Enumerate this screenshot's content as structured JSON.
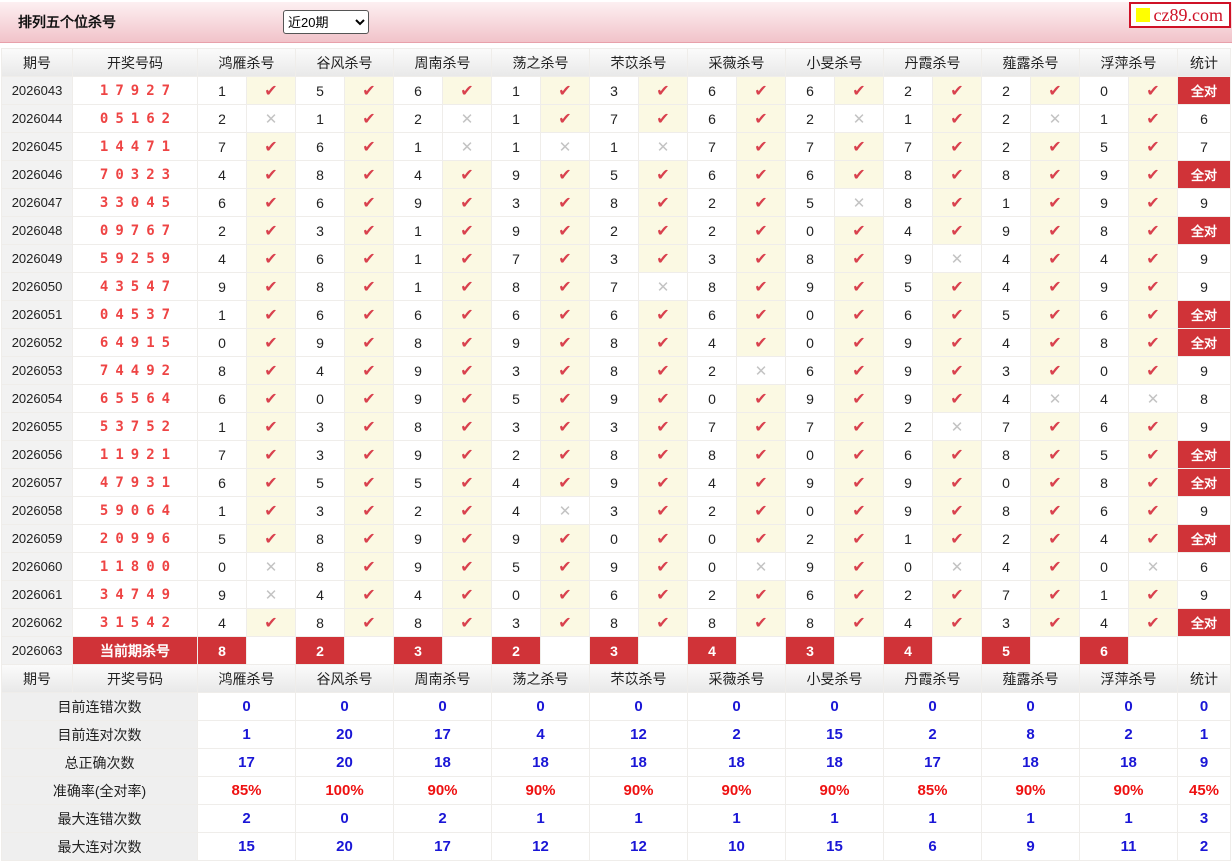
{
  "page": {
    "title": "排列五个位杀号",
    "period_select": "近20期",
    "logo": "cz89.com"
  },
  "icons": {
    "check": "✔",
    "cross": "✕",
    "logo_square": "yellow-square"
  },
  "colors": {
    "accent_red": "#d03338",
    "check_red": "#d9414e",
    "cross_gray": "#c3c3c3",
    "number_red": "#ee4444",
    "summary_blue": "#1a16d6",
    "percent_red": "#ee1111",
    "topbar_pink": "#f1c3ca"
  },
  "columns": {
    "period": "期号",
    "numbers": "开奖号码",
    "experts": [
      "鸿雁杀号",
      "谷风杀号",
      "周南杀号",
      "荡之杀号",
      "芣苡杀号",
      "采薇杀号",
      "小旻杀号",
      "丹霞杀号",
      "薤露杀号",
      "浮萍杀号"
    ],
    "stat": "统计"
  },
  "all_correct_label": "全对",
  "rows": [
    {
      "period": "2026043",
      "numbers": "17927",
      "kills": [
        [
          "1",
          1
        ],
        [
          "5",
          1
        ],
        [
          "6",
          1
        ],
        [
          "1",
          1
        ],
        [
          "3",
          1
        ],
        [
          "6",
          1
        ],
        [
          "6",
          1
        ],
        [
          "2",
          1
        ],
        [
          "2",
          1
        ],
        [
          "0",
          1
        ]
      ],
      "stat": "全对"
    },
    {
      "period": "2026044",
      "numbers": "05162",
      "kills": [
        [
          "2",
          0
        ],
        [
          "1",
          1
        ],
        [
          "2",
          0
        ],
        [
          "1",
          1
        ],
        [
          "7",
          1
        ],
        [
          "6",
          1
        ],
        [
          "2",
          0
        ],
        [
          "1",
          1
        ],
        [
          "2",
          0
        ],
        [
          "1",
          1
        ]
      ],
      "stat": "6"
    },
    {
      "period": "2026045",
      "numbers": "14471",
      "kills": [
        [
          "7",
          1
        ],
        [
          "6",
          1
        ],
        [
          "1",
          0
        ],
        [
          "1",
          0
        ],
        [
          "1",
          0
        ],
        [
          "7",
          1
        ],
        [
          "7",
          1
        ],
        [
          "7",
          1
        ],
        [
          "2",
          1
        ],
        [
          "5",
          1
        ]
      ],
      "stat": "7"
    },
    {
      "period": "2026046",
      "numbers": "70323",
      "kills": [
        [
          "4",
          1
        ],
        [
          "8",
          1
        ],
        [
          "4",
          1
        ],
        [
          "9",
          1
        ],
        [
          "5",
          1
        ],
        [
          "6",
          1
        ],
        [
          "6",
          1
        ],
        [
          "8",
          1
        ],
        [
          "8",
          1
        ],
        [
          "9",
          1
        ]
      ],
      "stat": "全对"
    },
    {
      "period": "2026047",
      "numbers": "33045",
      "kills": [
        [
          "6",
          1
        ],
        [
          "6",
          1
        ],
        [
          "9",
          1
        ],
        [
          "3",
          1
        ],
        [
          "8",
          1
        ],
        [
          "2",
          1
        ],
        [
          "5",
          0
        ],
        [
          "8",
          1
        ],
        [
          "1",
          1
        ],
        [
          "9",
          1
        ]
      ],
      "stat": "9"
    },
    {
      "period": "2026048",
      "numbers": "09767",
      "kills": [
        [
          "2",
          1
        ],
        [
          "3",
          1
        ],
        [
          "1",
          1
        ],
        [
          "9",
          1
        ],
        [
          "2",
          1
        ],
        [
          "2",
          1
        ],
        [
          "0",
          1
        ],
        [
          "4",
          1
        ],
        [
          "9",
          1
        ],
        [
          "8",
          1
        ]
      ],
      "stat": "全对"
    },
    {
      "period": "2026049",
      "numbers": "59259",
      "kills": [
        [
          "4",
          1
        ],
        [
          "6",
          1
        ],
        [
          "1",
          1
        ],
        [
          "7",
          1
        ],
        [
          "3",
          1
        ],
        [
          "3",
          1
        ],
        [
          "8",
          1
        ],
        [
          "9",
          0
        ],
        [
          "4",
          1
        ],
        [
          "4",
          1
        ]
      ],
      "stat": "9"
    },
    {
      "period": "2026050",
      "numbers": "43547",
      "kills": [
        [
          "9",
          1
        ],
        [
          "8",
          1
        ],
        [
          "1",
          1
        ],
        [
          "8",
          1
        ],
        [
          "7",
          0
        ],
        [
          "8",
          1
        ],
        [
          "9",
          1
        ],
        [
          "5",
          1
        ],
        [
          "4",
          1
        ],
        [
          "9",
          1
        ]
      ],
      "stat": "9"
    },
    {
      "period": "2026051",
      "numbers": "04537",
      "kills": [
        [
          "1",
          1
        ],
        [
          "6",
          1
        ],
        [
          "6",
          1
        ],
        [
          "6",
          1
        ],
        [
          "6",
          1
        ],
        [
          "6",
          1
        ],
        [
          "0",
          1
        ],
        [
          "6",
          1
        ],
        [
          "5",
          1
        ],
        [
          "6",
          1
        ]
      ],
      "stat": "全对"
    },
    {
      "period": "2026052",
      "numbers": "64915",
      "kills": [
        [
          "0",
          1
        ],
        [
          "9",
          1
        ],
        [
          "8",
          1
        ],
        [
          "9",
          1
        ],
        [
          "8",
          1
        ],
        [
          "4",
          1
        ],
        [
          "0",
          1
        ],
        [
          "9",
          1
        ],
        [
          "4",
          1
        ],
        [
          "8",
          1
        ]
      ],
      "stat": "全对"
    },
    {
      "period": "2026053",
      "numbers": "74492",
      "kills": [
        [
          "8",
          1
        ],
        [
          "4",
          1
        ],
        [
          "9",
          1
        ],
        [
          "3",
          1
        ],
        [
          "8",
          1
        ],
        [
          "2",
          0
        ],
        [
          "6",
          1
        ],
        [
          "9",
          1
        ],
        [
          "3",
          1
        ],
        [
          "0",
          1
        ]
      ],
      "stat": "9"
    },
    {
      "period": "2026054",
      "numbers": "65564",
      "kills": [
        [
          "6",
          1
        ],
        [
          "0",
          1
        ],
        [
          "9",
          1
        ],
        [
          "5",
          1
        ],
        [
          "9",
          1
        ],
        [
          "0",
          1
        ],
        [
          "9",
          1
        ],
        [
          "9",
          1
        ],
        [
          "4",
          0
        ],
        [
          "4",
          0
        ]
      ],
      "stat": "8"
    },
    {
      "period": "2026055",
      "numbers": "53752",
      "kills": [
        [
          "1",
          1
        ],
        [
          "3",
          1
        ],
        [
          "8",
          1
        ],
        [
          "3",
          1
        ],
        [
          "3",
          1
        ],
        [
          "7",
          1
        ],
        [
          "7",
          1
        ],
        [
          "2",
          0
        ],
        [
          "7",
          1
        ],
        [
          "6",
          1
        ]
      ],
      "stat": "9"
    },
    {
      "period": "2026056",
      "numbers": "11921",
      "kills": [
        [
          "7",
          1
        ],
        [
          "3",
          1
        ],
        [
          "9",
          1
        ],
        [
          "2",
          1
        ],
        [
          "8",
          1
        ],
        [
          "8",
          1
        ],
        [
          "0",
          1
        ],
        [
          "6",
          1
        ],
        [
          "8",
          1
        ],
        [
          "5",
          1
        ]
      ],
      "stat": "全对"
    },
    {
      "period": "2026057",
      "numbers": "47931",
      "kills": [
        [
          "6",
          1
        ],
        [
          "5",
          1
        ],
        [
          "5",
          1
        ],
        [
          "4",
          1
        ],
        [
          "9",
          1
        ],
        [
          "4",
          1
        ],
        [
          "9",
          1
        ],
        [
          "9",
          1
        ],
        [
          "0",
          1
        ],
        [
          "8",
          1
        ]
      ],
      "stat": "全对"
    },
    {
      "period": "2026058",
      "numbers": "59064",
      "kills": [
        [
          "1",
          1
        ],
        [
          "3",
          1
        ],
        [
          "2",
          1
        ],
        [
          "4",
          0
        ],
        [
          "3",
          1
        ],
        [
          "2",
          1
        ],
        [
          "0",
          1
        ],
        [
          "9",
          1
        ],
        [
          "8",
          1
        ],
        [
          "6",
          1
        ]
      ],
      "stat": "9"
    },
    {
      "period": "2026059",
      "numbers": "20996",
      "kills": [
        [
          "5",
          1
        ],
        [
          "8",
          1
        ],
        [
          "9",
          1
        ],
        [
          "9",
          1
        ],
        [
          "0",
          1
        ],
        [
          "0",
          1
        ],
        [
          "2",
          1
        ],
        [
          "1",
          1
        ],
        [
          "2",
          1
        ],
        [
          "4",
          1
        ]
      ],
      "stat": "全对"
    },
    {
      "period": "2026060",
      "numbers": "11800",
      "kills": [
        [
          "0",
          0
        ],
        [
          "8",
          1
        ],
        [
          "9",
          1
        ],
        [
          "5",
          1
        ],
        [
          "9",
          1
        ],
        [
          "0",
          0
        ],
        [
          "9",
          1
        ],
        [
          "0",
          0
        ],
        [
          "4",
          1
        ],
        [
          "0",
          0
        ]
      ],
      "stat": "6"
    },
    {
      "period": "2026061",
      "numbers": "34749",
      "kills": [
        [
          "9",
          0
        ],
        [
          "4",
          1
        ],
        [
          "4",
          1
        ],
        [
          "0",
          1
        ],
        [
          "6",
          1
        ],
        [
          "2",
          1
        ],
        [
          "6",
          1
        ],
        [
          "2",
          1
        ],
        [
          "7",
          1
        ],
        [
          "1",
          1
        ]
      ],
      "stat": "9"
    },
    {
      "period": "2026062",
      "numbers": "31542",
      "kills": [
        [
          "4",
          1
        ],
        [
          "8",
          1
        ],
        [
          "8",
          1
        ],
        [
          "3",
          1
        ],
        [
          "8",
          1
        ],
        [
          "8",
          1
        ],
        [
          "8",
          1
        ],
        [
          "4",
          1
        ],
        [
          "3",
          1
        ],
        [
          "4",
          1
        ]
      ],
      "stat": "全对"
    }
  ],
  "current_row": {
    "period": "2026063",
    "label": "当前期杀号",
    "kills": [
      "8",
      "2",
      "3",
      "2",
      "3",
      "4",
      "3",
      "4",
      "5",
      "6"
    ],
    "stat": ""
  },
  "summary": [
    {
      "label": "目前连错次数",
      "red": false,
      "values": [
        "0",
        "0",
        "0",
        "0",
        "0",
        "0",
        "0",
        "0",
        "0",
        "0",
        "0"
      ]
    },
    {
      "label": "目前连对次数",
      "red": false,
      "values": [
        "1",
        "20",
        "17",
        "4",
        "12",
        "2",
        "15",
        "2",
        "8",
        "2",
        "1"
      ]
    },
    {
      "label": "总正确次数",
      "red": false,
      "values": [
        "17",
        "20",
        "18",
        "18",
        "18",
        "18",
        "18",
        "17",
        "18",
        "18",
        "9"
      ]
    },
    {
      "label": "准确率(全对率)",
      "red": true,
      "values": [
        "85%",
        "100%",
        "90%",
        "90%",
        "90%",
        "90%",
        "90%",
        "85%",
        "90%",
        "90%",
        "45%"
      ]
    },
    {
      "label": "最大连错次数",
      "red": false,
      "values": [
        "2",
        "0",
        "2",
        "1",
        "1",
        "1",
        "1",
        "1",
        "1",
        "1",
        "3"
      ]
    },
    {
      "label": "最大连对次数",
      "red": false,
      "values": [
        "15",
        "20",
        "17",
        "12",
        "12",
        "10",
        "15",
        "6",
        "9",
        "11",
        "2"
      ]
    }
  ]
}
